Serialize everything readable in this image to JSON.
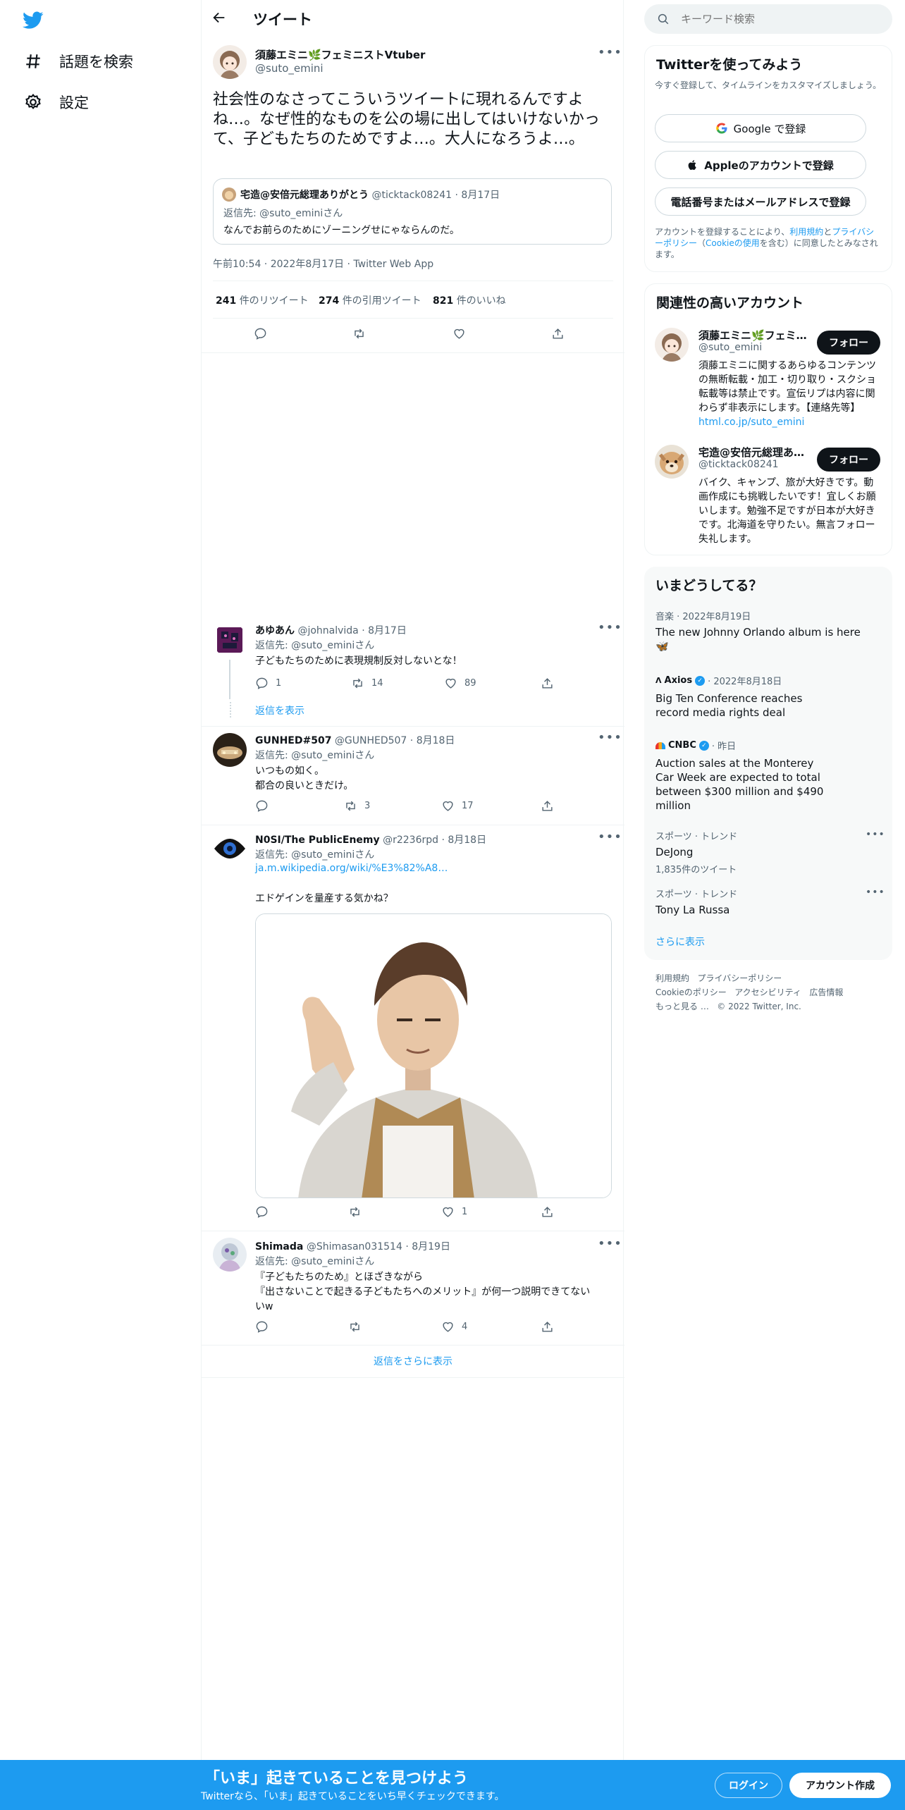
{
  "nav": {
    "explore_label": "話題を検索",
    "settings_label": "設定"
  },
  "header": {
    "title": "ツイート"
  },
  "main_tweet": {
    "author_name": "須藤エミニ🌿フェミニストVtuber",
    "author_handle": "@suto_emini",
    "text": "社会性のなさってこういうツイートに現れるんですよね…。なぜ性的なものを公の場に出してはいけないかって、子どもたちのためですよ…。大人になろうよ…。",
    "quoted": {
      "author_name": "宅造@安倍元総理ありがとう",
      "author_handle": "@ticktack08241",
      "date": "8月17日",
      "reply_to": "返信先: @suto_eminiさん",
      "text": "なんでお前らのためにゾーニングせにゃならんのだ。"
    },
    "timestamp": "午前10:54 · 2022年8月17日 · Twitter Web App",
    "stats": {
      "retweets_count": "241",
      "retweets_label": "件のリツイート",
      "quotes_count": "274",
      "quotes_label": "件の引用ツイート",
      "likes_count": "821",
      "likes_label": "件のいいね"
    }
  },
  "replies": [
    {
      "name": "あゆあん",
      "handle": "@johnalvida",
      "date": "· 8月17日",
      "reply_to": "返信先: @suto_eminiさん",
      "text": "子どもたちのために表現規制反対しないとな！",
      "replies": "1",
      "retweets": "14",
      "likes": "89",
      "show_replies": "返信を表示"
    },
    {
      "name": "GUNHED#507",
      "handle": "@GUNHED507",
      "date": "· 8月18日",
      "reply_to": "返信先: @suto_eminiさん",
      "text_line1": "いつもの如く。",
      "text_line2": "都合の良いときだけ。",
      "retweets": "3",
      "likes": "17"
    },
    {
      "name": "N0SI/The PublicEnemy",
      "handle": "@r2236rpd",
      "date": "· 8月18日",
      "reply_to": "返信先: @suto_eminiさん",
      "link": "ja.m.wikipedia.org/wiki/%E3%82%A8…",
      "text": "エドゲインを量産する気かね？",
      "likes": "1"
    },
    {
      "name": "Shimada",
      "handle": "@Shimasan031514",
      "date": "· 8月19日",
      "reply_to": "返信先: @suto_eminiさん",
      "text_line1": "『子どもたちのため』とほざきながら",
      "text_line2": "『出さないことで起きる子どもたちへのメリット』が何一つ説明できてない",
      "text_line3": "いw",
      "likes": "4"
    }
  ],
  "show_more_replies": "返信をさらに表示",
  "right": {
    "search_placeholder": "キーワード検索",
    "signup": {
      "title": "Twitterを使ってみよう",
      "subtitle": "今すぐ登録して、タイムラインをカスタマイズしましょう。",
      "google_label": "Google で登録",
      "apple_label": "Appleのアカウントで登録",
      "phone_label": "電話番号またはメールアドレスで登録",
      "terms_prefix": "アカウントを登録することにより、",
      "terms_link": "利用規約",
      "terms_and": "と",
      "privacy_link": "プライバシーポリシー",
      "cookie_prefix": "（",
      "cookie_link": "Cookieの使用",
      "terms_suffix": "を含む）に同意したとみなされます。"
    },
    "related": {
      "title": "関連性の高いアカウント",
      "accounts": [
        {
          "name": "須藤エミニ🌿フェミ…",
          "handle": "@suto_emini",
          "follow": "フォロー",
          "bio": "須藤エミニに関するあらゆるコンテンツの無断転載・加工・切り取り・スクショ転載等は禁止です。宣伝リプは内容に関わらず非表示にします。【連絡先等】",
          "bio_link": "html.co.jp/suto_emini"
        },
        {
          "name": "宅造@安倍元総理あ…",
          "handle": "@ticktack08241",
          "follow": "フォロー",
          "bio": "バイク、キャンプ、旅が大好きです。動画作成にも挑戦したいです！宜しくお願いします。勉強不足ですが日本が大好きです。北海道を守りたい。無言フォロー失礼します。"
        }
      ]
    },
    "trends": {
      "title": "いまどうしてる？",
      "items": [
        {
          "meta": "音楽 · 2022年8月19日",
          "title": "The new Johnny Orlando album is here 🦋"
        },
        {
          "meta_source": "Axios",
          "meta_date": "· 2022年8月18日",
          "title": "Big Ten Conference reaches record media rights deal"
        },
        {
          "meta_source": "CNBC",
          "meta_date": "· 昨日",
          "title": "Auction sales at the Monterey Car Week are expected to total between $300 million and $490 million"
        },
        {
          "meta": "スポーツ · トレンド",
          "title": "DeJong",
          "count": "1,835件のツイート"
        },
        {
          "meta": "スポーツ · トレンド",
          "title": "Tony La Russa"
        }
      ],
      "show_more": "さらに表示"
    },
    "footer": {
      "terms": "利用規約",
      "privacy": "プライバシーポリシー",
      "cookie": "Cookieのポリシー",
      "accessibility": "アクセシビリティ",
      "ads": "広告情報",
      "more": "もっと見る …",
      "copyright": "© 2022 Twitter, Inc."
    }
  },
  "bottombar": {
    "title": "「いま」起きていることを見つけよう",
    "subtitle": "Twitterなら、「いま」起きていることをいち早くチェックできます。",
    "login": "ログイン",
    "signup": "アカウント作成"
  },
  "colors": {
    "brand": "#1d9bf0",
    "text": "#0f1419",
    "muted": "#536471"
  }
}
